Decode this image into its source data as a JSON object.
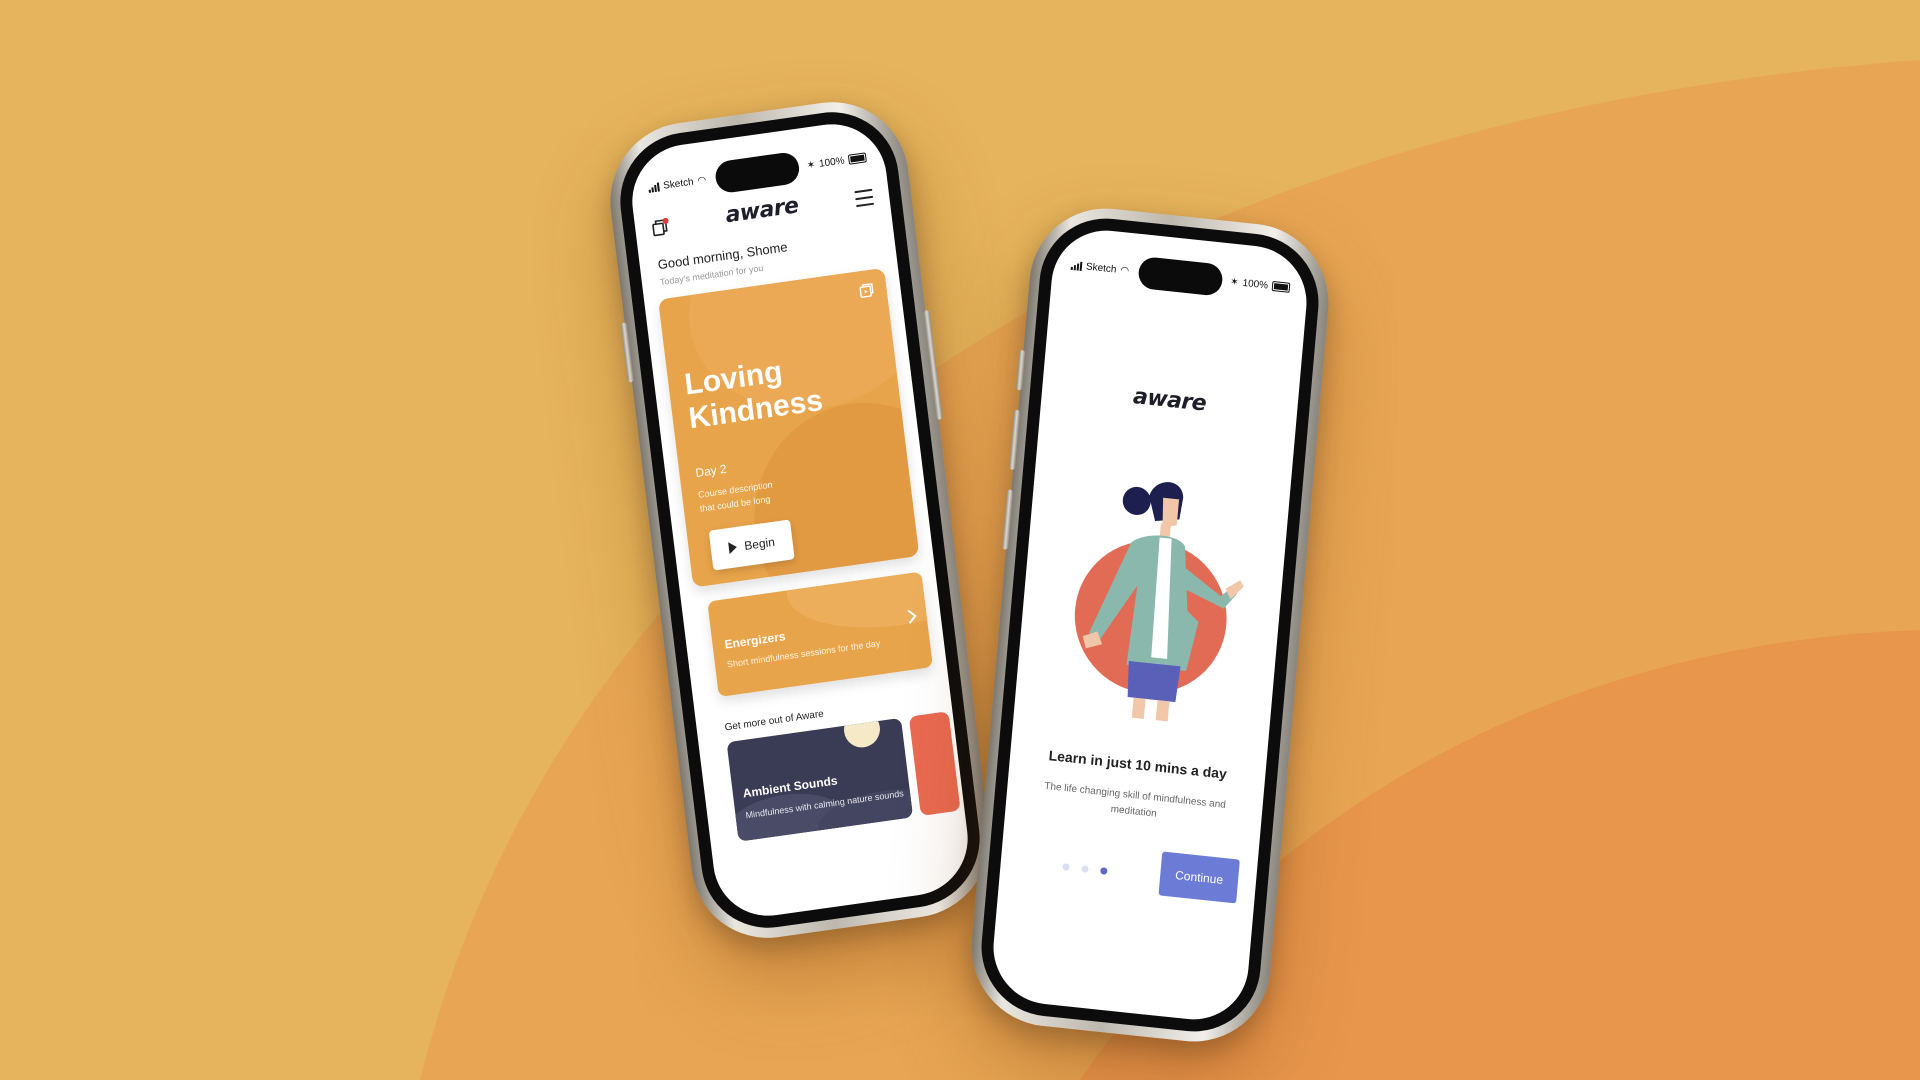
{
  "colors": {
    "background": "#e6b45c",
    "accent_orange": "#e8a44a",
    "accent_purple": "#6b7bd6",
    "dark_card": "#3a3b55",
    "coral": "#e96a50"
  },
  "phone1": {
    "status": {
      "carrier": "Sketch",
      "battery": "100%"
    },
    "header": {
      "logo": "aware",
      "left_icon": "library-icon",
      "right_icon": "menu-icon"
    },
    "greeting": "Good morning, Shome",
    "greeting_sub": "Today's meditation for you",
    "hero": {
      "title": "Loving Kindness",
      "day": "Day 2",
      "description": "Course description that could be long",
      "button": "Begin"
    },
    "energizers": {
      "title": "Energizers",
      "subtitle": "Short mindfulness sessions for the day"
    },
    "more_heading": "Get more out of Aware",
    "ambient": {
      "title": "Ambient Sounds",
      "subtitle": "Mindfulness with calming nature sounds"
    }
  },
  "phone2": {
    "status": {
      "carrier": "Sketch",
      "battery": "100%"
    },
    "logo": "aware",
    "title": "Learn in just 10 mins a day",
    "subtitle": "The life changing skill of mindfulness and meditation",
    "pagination": {
      "total": 3,
      "active": 3
    },
    "button": "Continue"
  }
}
